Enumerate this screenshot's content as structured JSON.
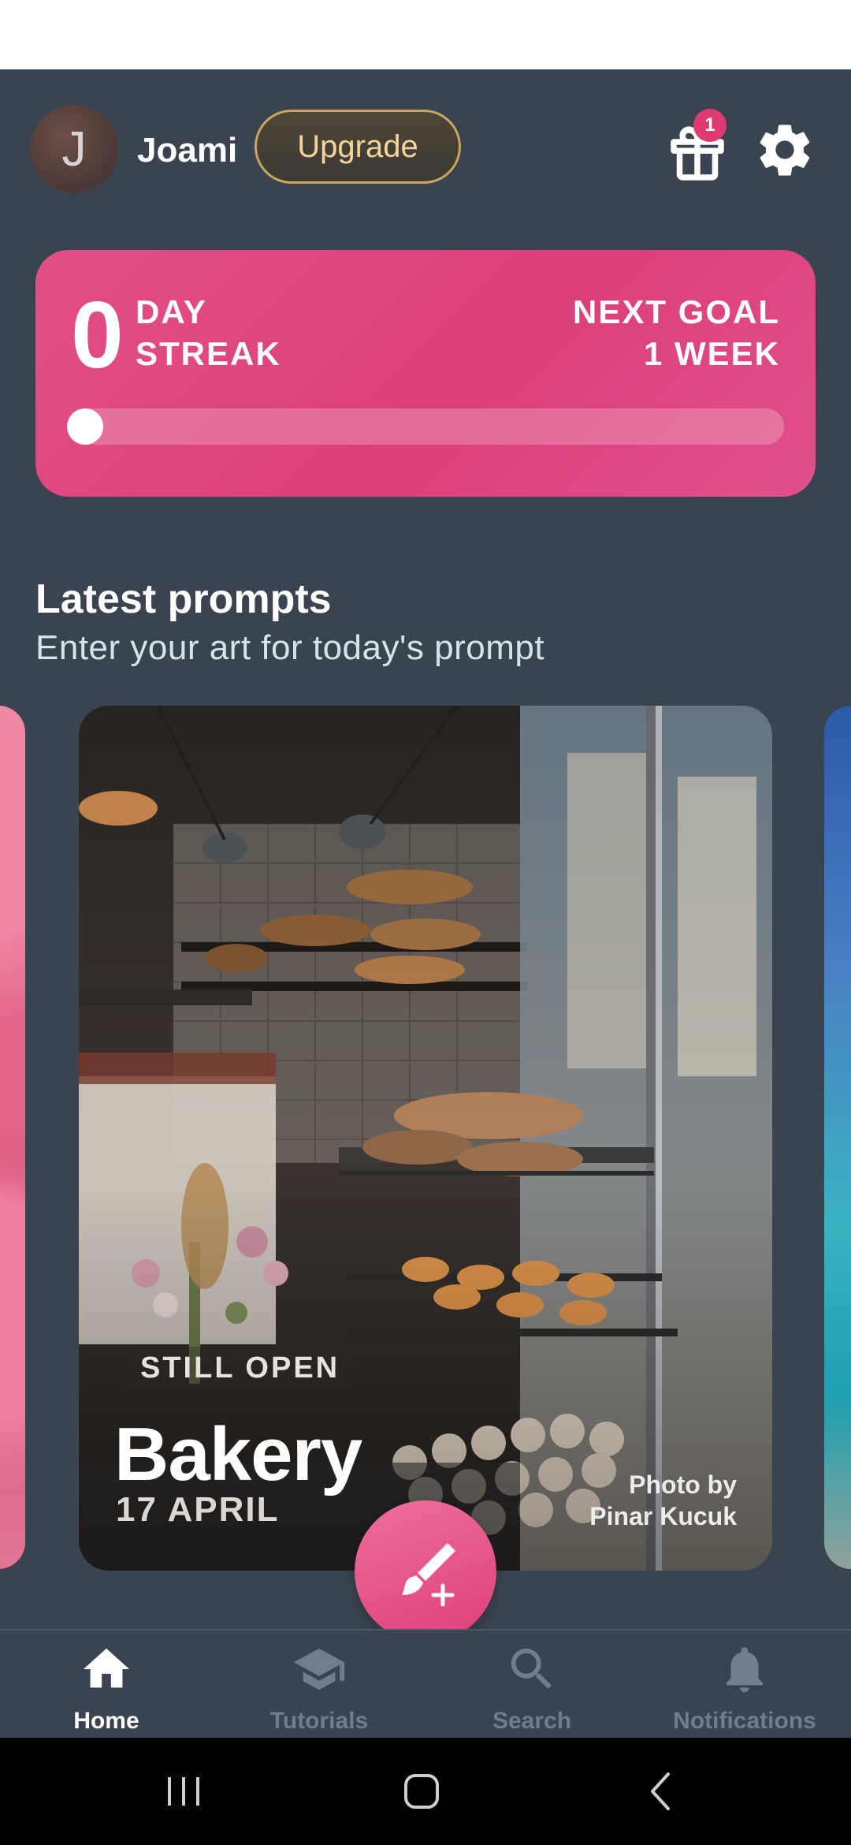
{
  "header": {
    "avatar_letter": "J",
    "username": "Joami",
    "upgrade_label": "Upgrade",
    "gift_badge_count": "1",
    "icons": [
      "gift-icon",
      "gear-icon"
    ]
  },
  "streak": {
    "count": "0",
    "label_line1": "DAY",
    "label_line2": "STREAK",
    "goal_line1": "NEXT GOAL",
    "goal_line2": "1 WEEK",
    "progress_fraction": 0.0
  },
  "section": {
    "title": "Latest prompts",
    "subtitle": "Enter your art for today's prompt"
  },
  "prompt_card": {
    "status": "STILL OPEN",
    "title": "Bakery",
    "date": "17 APRIL",
    "credit_line1": "Photo by",
    "credit_line2": "Pinar Kucuk"
  },
  "fab": {
    "icon": "brush-plus-icon"
  },
  "bottom_nav": {
    "items": [
      {
        "label": "Home",
        "icon": "home-icon",
        "active": true
      },
      {
        "label": "Tutorials",
        "icon": "graduation-cap-icon",
        "active": false
      },
      {
        "label": "Search",
        "icon": "search-icon",
        "active": false
      },
      {
        "label": "Notifications",
        "icon": "bell-icon",
        "active": false
      }
    ]
  },
  "colors": {
    "background": "#3a4450",
    "accent_pink": "#e24f86",
    "upgrade_gold": "#c9a55f",
    "nav_inactive": "#737d89"
  }
}
